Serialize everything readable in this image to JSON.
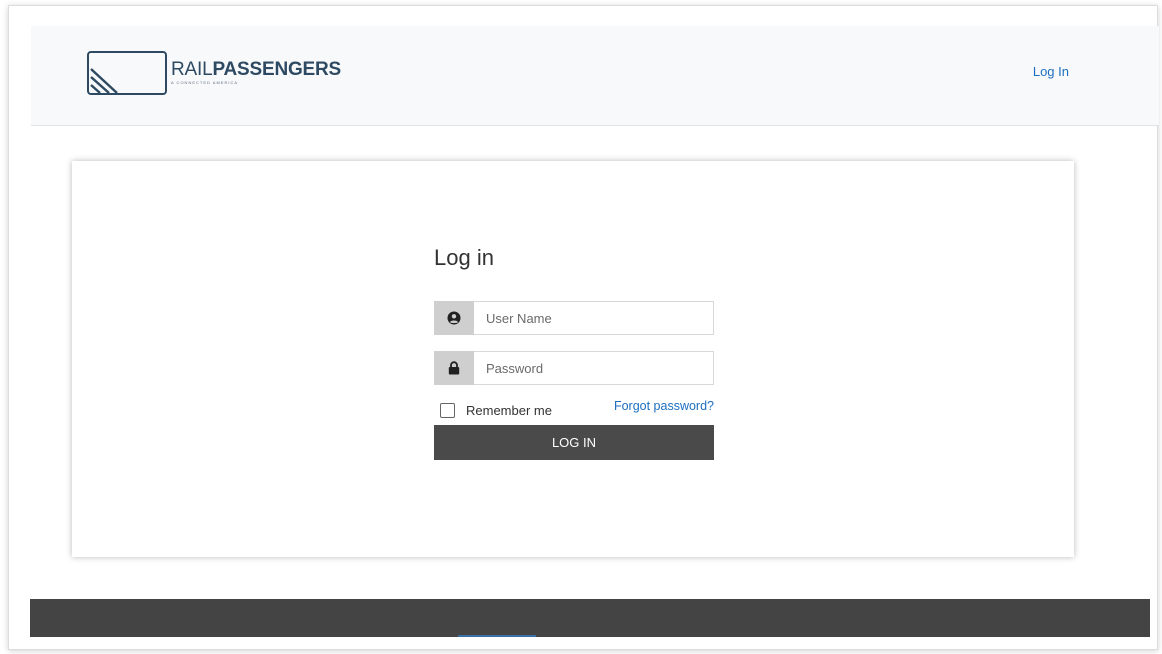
{
  "header": {
    "logo": {
      "name_light": "RAIL",
      "name_bold": "PASSENGERS",
      "tagline": "A CONNECTED AMERICA",
      "mark_icon": "rail-logo-icon"
    },
    "login_link": "Log In"
  },
  "login_form": {
    "title": "Log in",
    "username": {
      "placeholder": "User Name",
      "value": "",
      "icon": "user-circle-icon"
    },
    "password": {
      "placeholder": "Password",
      "value": "",
      "icon": "lock-icon"
    },
    "remember_label": "Remember me",
    "remember_checked": false,
    "forgot_link": "Forgot password?",
    "submit_label": "LOG IN"
  },
  "colors": {
    "brand_navy": "#2e4a62",
    "link_blue": "#1c6fc0",
    "button_dark": "#4a4a4a",
    "footer_dark": "#444444",
    "header_bg": "#f8f9fb"
  }
}
